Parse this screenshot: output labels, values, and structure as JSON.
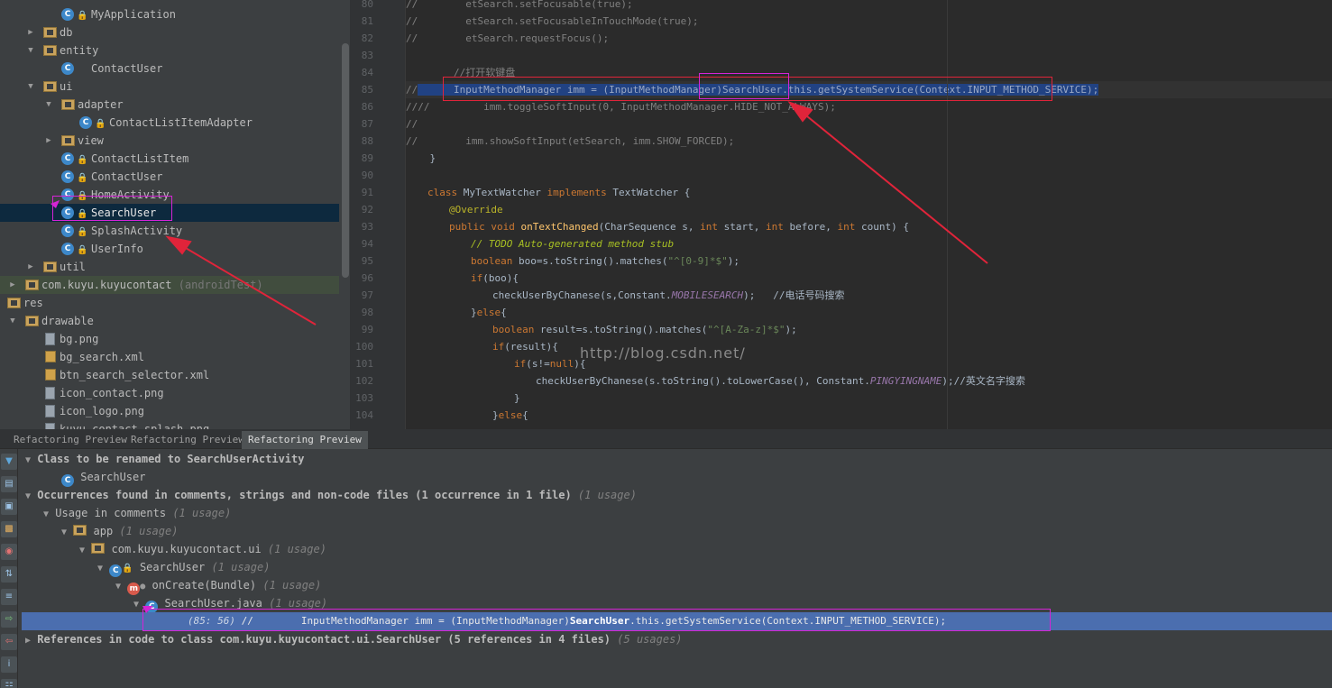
{
  "tree": {
    "rows": [
      {
        "label": "MyApplication",
        "icon": "class-icon"
      },
      {
        "label": "db",
        "icon": "package-icon"
      },
      {
        "label": "entity",
        "icon": "package-icon"
      },
      {
        "label": "ContactUser",
        "icon": "class-icon"
      },
      {
        "label": "ui",
        "icon": "package-icon"
      },
      {
        "label": "adapter",
        "icon": "package-icon"
      },
      {
        "label": "ContactListItemAdapter",
        "icon": "class-icon"
      },
      {
        "label": "view",
        "icon": "package-icon"
      },
      {
        "label": "ContactListItem",
        "icon": "class-icon"
      },
      {
        "label": "ContactUser",
        "icon": "class-icon"
      },
      {
        "label": "HomeActivity",
        "icon": "class-icon"
      },
      {
        "label": "SearchUser",
        "icon": "class-icon"
      },
      {
        "label": "SplashActivity",
        "icon": "class-icon"
      },
      {
        "label": "UserInfo",
        "icon": "class-icon"
      },
      {
        "label": "util",
        "icon": "package-icon"
      },
      {
        "label": "com.kuyu.kuyucontact",
        "suffix": "(androidTest)",
        "icon": "package-icon"
      },
      {
        "label": "res",
        "icon": "folder-icon"
      },
      {
        "label": "drawable",
        "icon": "folder-icon"
      },
      {
        "label": "bg.png",
        "icon": "image-file-icon"
      },
      {
        "label": "bg_search.xml",
        "icon": "xml-file-icon"
      },
      {
        "label": "btn_search_selector.xml",
        "icon": "xml-file-icon"
      },
      {
        "label": "icon_contact.png",
        "icon": "image-file-icon"
      },
      {
        "label": "icon_logo.png",
        "icon": "image-file-icon"
      },
      {
        "label": "kuyu_contact_splash.png",
        "icon": "image-file-icon"
      }
    ]
  },
  "editor": {
    "line_numbers": [
      "80",
      "81",
      "82",
      "83",
      "84",
      "85",
      "86",
      "87",
      "88",
      "89",
      "90",
      "91",
      "92",
      "93",
      "94",
      "95",
      "96",
      "97",
      "98",
      "99",
      "100",
      "101",
      "102",
      "103",
      "104"
    ],
    "lines": {
      "l80": {
        "a": "//",
        "b": "        etSearch.setFocusable(true);"
      },
      "l81": {
        "a": "//",
        "b": "        etSearch.setFocusableInTouchMode(true);"
      },
      "l82": {
        "a": "//",
        "b": "        etSearch.requestFocus();"
      },
      "l84": "        //打开软键盘",
      "l85": {
        "a": "//",
        "b": "      InputMethodManager imm = (InputMethodManager)SearchUser.this.getSystemService(Context.INPUT_METHOD_SERVICE);"
      },
      "l86": {
        "a": "////",
        "b": "         imm.toggleSoftInput(0, InputMethodManager.HIDE_NOT_ALWAYS);"
      },
      "l87": "//",
      "l88": {
        "a": "//",
        "b": "        imm.showSoftInput(etSearch, imm.SHOW_FORCED);"
      },
      "l89": "    }",
      "l91": {
        "kw1": "class",
        "name": " MyTextWatcher ",
        "kw2": "implements",
        "rest": " TextWatcher {"
      },
      "l92": "@Override",
      "l93": {
        "kw": "public void",
        "fn": "onTextChanged",
        "rest": "(CharSequence s, ",
        "kw2": "int",
        "r2": " start, ",
        "kw3": "int",
        "r3": " before, ",
        "kw4": "int",
        "r4": " count) {"
      },
      "l94": "// TODO Auto-generated method stub",
      "l95": {
        "kw": "boolean",
        "r1": " boo=s.toString().matches(",
        "str": "\"^[0-9]*$\"",
        "r2": ");"
      },
      "l96": {
        "kw": "if",
        "r": "(boo){"
      },
      "l97": {
        "r1": "checkUserByChanese(s,Constant.",
        "it": "MOBILESEARCH",
        "r2": ");   //电话号码搜索"
      },
      "l98": {
        "r1": "}",
        "kw": "else",
        "r2": "{"
      },
      "l99": {
        "kw": "boolean",
        "r1": " result=s.toString().matches(",
        "str": "\"^[A-Za-z]*$\"",
        "r2": ");"
      },
      "l100": {
        "kw": "if",
        "r": "(result){"
      },
      "l101": {
        "kw": "if",
        "r1": "(s!=",
        "kw2": "null",
        "r2": "){"
      },
      "l102": {
        "r1": "checkUserByChanese(s.toString().toLowerCase(), Constant.",
        "it": "PINGYINGNAME",
        "r2": ");//英文名字搜索"
      },
      "l103": "}",
      "l104": {
        "r1": "}",
        "kw": "else",
        "r2": "{"
      }
    },
    "watermark": "http://blog.csdn.net/"
  },
  "bottom": {
    "tabs": [
      "Refactoring Preview",
      "Refactoring Preview",
      "Refactoring Preview"
    ],
    "rows": {
      "r1": "Class to be renamed to SearchUserActivity",
      "r2": "SearchUser",
      "r3": "Occurrences found in comments, strings and non-code files  (1 occurrence in 1 file)",
      "r3dim": "(1 usage)",
      "r4": "Usage in comments",
      "r4dim": "(1 usage)",
      "r5": "app",
      "r5dim": "(1 usage)",
      "r6": "com.kuyu.kuyucontact.ui",
      "r6dim": "(1 usage)",
      "r7": "SearchUser",
      "r7dim": "(1 usage)",
      "r8": "onCreate(Bundle)",
      "r8dim": "(1 usage)",
      "r9": "SearchUser.java",
      "r9dim": "(1 usage)",
      "r10pos": "(85: 56)",
      "r10a": "//        InputMethodManager imm = (InputMethodManager)",
      "r10b": "SearchUser",
      "r10c": ".this.getSystemService(Context.INPUT_METHOD_SERVICE);",
      "r11": "References in code to class com.kuyu.kuyucontact.ui.SearchUser (5 references in 4 files)",
      "r11dim": "(5 usages)"
    }
  },
  "colors": {
    "annotation_red": "#e0243a",
    "annotation_magenta": "#d524d6",
    "selection_blue": "#4b6eaf"
  }
}
